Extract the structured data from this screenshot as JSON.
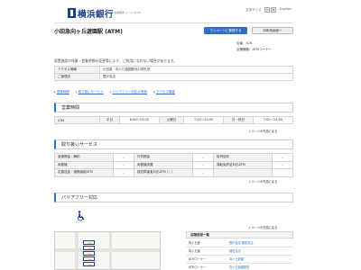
{
  "header": {
    "logo": "横浜銀行",
    "logo_sub": "金融機関コード:0138",
    "font_size_label": "文字サイズ",
    "size_small": "小",
    "size_large": "大",
    "language": "English"
  },
  "page": {
    "title": "小田急向ヶ丘遊園駅 (ATM)",
    "register_button": "マイページに登録する",
    "print_button": "印刷用画面へ",
    "store_number": "店番：826",
    "store_type": "店舗種類：ATMコーナー",
    "notice": "設置施設の休業・営業時間の変更等により、ご利用になれない場合があります。"
  },
  "info": [
    {
      "label": "アクセス情報",
      "value": "小田急　向ヶ丘遊園駅北口改札前"
    },
    {
      "label": "ご管理店",
      "value": "登戸支店"
    }
  ],
  "anchors": [
    "営業時間",
    "取り扱いサービス",
    "バリアフリー対応の有無",
    "アクセス情報"
  ],
  "hours": {
    "heading": "営業時間",
    "row_label": "ATM",
    "columns": [
      {
        "day": "平日",
        "time": "6:00～24:00"
      },
      {
        "day": "土曜日",
        "time": "7:00～24:00"
      },
      {
        "day": "日・祝日",
        "time": "7:00～24:00"
      }
    ]
  },
  "back_to_top": "ページの先頭に戻る",
  "services": {
    "heading": "取り扱いサービス",
    "rows": [
      [
        {
          "label": "普通預金・解約",
          "value": "-"
        },
        {
          "label": "外貨預金",
          "value": "-"
        },
        {
          "label": "投資信託",
          "value": "-"
        }
      ],
      [
        {
          "label": "両替機",
          "value": "-"
        },
        {
          "label": "両替機設置",
          "value": "-"
        },
        {
          "label": "運転免許証対応ATM",
          "value": "-"
        }
      ],
      [
        {
          "label": "定額送金・通帳繰越ATM",
          "value": "-"
        },
        {
          "label": "視覚障害者対応ATM (！)",
          "value": "-"
        },
        {
          "label": "",
          "value": ""
        }
      ]
    ]
  },
  "barrier_free": {
    "heading": "バリアフリー対応"
  },
  "map": {
    "labels": [
      "こちら",
      "こちら",
      "こちら",
      "こちら",
      "こちら"
    ]
  },
  "branch_list": {
    "heading": "店舗目録一覧",
    "rows": [
      {
        "key": "向ヶ丘遊",
        "value": "登戸支店 稲田支店"
      },
      {
        "key": "向ヶ丘遊",
        "value": "稲田支店"
      },
      {
        "key": "ATMコーナー",
        "value": "向ヶ丘遊園"
      },
      {
        "key": "ATMコーナー",
        "value": "向ヶ丘遊園駅前"
      }
    ]
  },
  "colors": {
    "accent": "#2e6fc7",
    "brand": "#1c3f8f",
    "arrow": "#dd3333"
  }
}
